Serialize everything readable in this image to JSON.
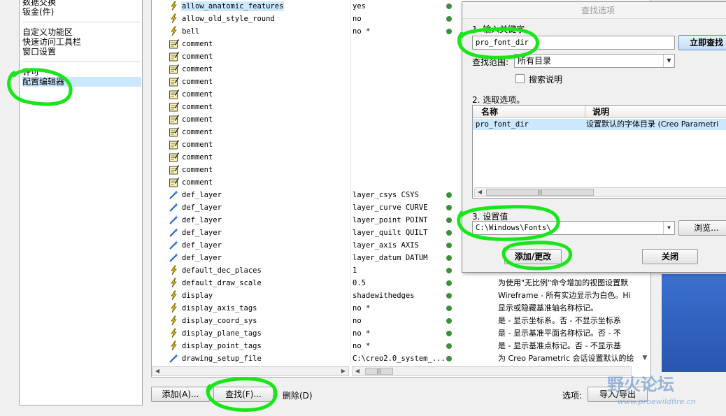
{
  "left_nav": {
    "items": [
      "数据交换",
      "钣金(件)",
      "自定义功能区",
      "快速访问工具栏",
      "窗口设置",
      "许可",
      "配置编辑器"
    ]
  },
  "options": [
    {
      "icon": "lightning",
      "name": "allow_anatomic_features",
      "value": "yes",
      "dot": true,
      "highlight": true
    },
    {
      "icon": "lightning",
      "name": "allow_old_style_round",
      "value": "no",
      "dot": true
    },
    {
      "icon": "lightning",
      "name": "bell",
      "value": "no *",
      "dot": true
    },
    {
      "icon": "comment",
      "name": "comment",
      "value": "",
      "dot": false
    },
    {
      "icon": "comment",
      "name": "comment",
      "value": "",
      "dot": false
    },
    {
      "icon": "comment",
      "name": "comment",
      "value": "",
      "dot": false
    },
    {
      "icon": "comment",
      "name": "comment",
      "value": "",
      "dot": false
    },
    {
      "icon": "comment",
      "name": "comment",
      "value": "",
      "dot": false
    },
    {
      "icon": "comment",
      "name": "comment",
      "value": "",
      "dot": false
    },
    {
      "icon": "comment",
      "name": "comment",
      "value": "",
      "dot": false
    },
    {
      "icon": "comment",
      "name": "comment",
      "value": "",
      "dot": false
    },
    {
      "icon": "comment",
      "name": "comment",
      "value": "",
      "dot": false
    },
    {
      "icon": "comment",
      "name": "comment",
      "value": "",
      "dot": false
    },
    {
      "icon": "comment",
      "name": "comment",
      "value": "",
      "dot": false
    },
    {
      "icon": "comment",
      "name": "comment",
      "value": "",
      "dot": false
    },
    {
      "icon": "wand",
      "name": "def_layer",
      "value": "layer_csys CSYS",
      "dot": true
    },
    {
      "icon": "wand",
      "name": "def_layer",
      "value": "layer_curve CURVE",
      "dot": true
    },
    {
      "icon": "wand",
      "name": "def_layer",
      "value": "layer_point POINT",
      "dot": true
    },
    {
      "icon": "wand",
      "name": "def_layer",
      "value": "layer_quilt QUILT",
      "dot": true
    },
    {
      "icon": "wand",
      "name": "def_layer",
      "value": "layer_axis AXIS",
      "dot": true
    },
    {
      "icon": "wand",
      "name": "def_layer",
      "value": "layer_datum DATUM",
      "dot": true
    },
    {
      "icon": "lightning",
      "name": "default_dec_places",
      "value": "1",
      "dot": true
    },
    {
      "icon": "lightning",
      "name": "default_draw_scale",
      "value": "0.5",
      "dot": true,
      "desc": "为使用\"无比例\"命令增加的视图设置默"
    },
    {
      "icon": "lightning",
      "name": "display",
      "value": "shadewithedges",
      "dot": true,
      "desc": "Wireframe - 所有实边显示为白色。Hi"
    },
    {
      "icon": "lightning",
      "name": "display_axis_tags",
      "value": "no *",
      "dot": true,
      "desc": "显示或隐藏基准轴名称标记。"
    },
    {
      "icon": "lightning",
      "name": "display_coord_sys",
      "value": "no",
      "dot": true,
      "desc": "是 - 显示坐标系。否 - 不显示坐标系"
    },
    {
      "icon": "lightning",
      "name": "display_plane_tags",
      "value": "no *",
      "dot": true,
      "desc": "是 - 显示基准平面名称标记。否 - 不"
    },
    {
      "icon": "lightning",
      "name": "display_point_tags",
      "value": "no *",
      "dot": true,
      "desc": "是 - 显示基准点标记。否 - 不显示基"
    },
    {
      "icon": "wand",
      "name": "drawing_setup_file",
      "value": "C:\\creo2.0_system_...",
      "dot": true,
      "desc": "为 Creo Parametric 会话设置默认的绘"
    }
  ],
  "bottom": {
    "add": "添加(A)...",
    "find": "查找(F)...",
    "delete": "删除(D)",
    "options_label": "选项:",
    "import_export": "导入/导出"
  },
  "dialog": {
    "title": "查找选项",
    "step1": "1.  输入关键字",
    "keyword": "pro_font_dir",
    "find_now": "立即查找",
    "scope_label": "查找范围:",
    "scope_value": "所有目录",
    "search_desc": "搜索说明",
    "step2": "2.  选取选项。",
    "col_name": "名称",
    "col_desc": "说明",
    "result_name": "pro_font_dir",
    "result_desc": "设置默认的字体目录 (Creo Parametri",
    "step3": "3.  设置值",
    "value": "C:\\Windows\\Fonts\\",
    "browse": "浏览...",
    "add_change": "添加/更改",
    "close": "关闭"
  },
  "watermark": {
    "text": "野火论坛",
    "url": "www.proewildfire.cn"
  },
  "colors": {
    "highlight": "#cce8ff",
    "annotation_green": "#19e619",
    "dot_green": "#3e8e3e"
  }
}
